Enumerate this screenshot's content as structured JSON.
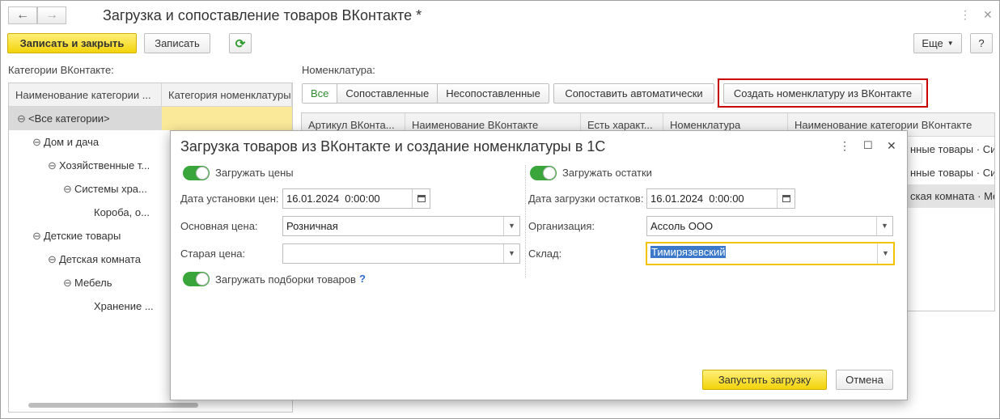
{
  "window": {
    "title": "Загрузка и сопоставление товаров ВКонтакте *"
  },
  "toolbar": {
    "save_close": "Записать и закрыть",
    "save": "Записать",
    "more": "Еще",
    "help": "?"
  },
  "left": {
    "label": "Категории ВКонтакте:",
    "columns": [
      "Наименование категории ...",
      "Категория номенклатуры"
    ],
    "rows": [
      {
        "text": "<Все категории>",
        "toggle": "⊖"
      },
      {
        "text": "Дом и дача",
        "toggle": "⊖"
      },
      {
        "text": "Хозяйственные т...",
        "toggle": "⊖"
      },
      {
        "text": "Системы хра...",
        "toggle": "⊖"
      },
      {
        "text": "Короба, о...",
        "toggle": ""
      },
      {
        "text": "Детские товары",
        "toggle": "⊖"
      },
      {
        "text": "Детская комната",
        "toggle": "⊖"
      },
      {
        "text": "Мебель",
        "toggle": "⊖"
      },
      {
        "text": "Хранение ...",
        "toggle": ""
      }
    ]
  },
  "right": {
    "label": "Номенклатура:",
    "filters": [
      "Все",
      "Сопоставленные",
      "Несопоставленные"
    ],
    "auto_match": "Сопоставить автоматически",
    "create_btn": "Создать номенклатуру из ВКонтакте",
    "columns": [
      "Артикул ВКонта...",
      "Наименование ВКонтакте",
      "Есть характ...",
      "Номенклатура",
      "Наименование категории ВКонтакте"
    ],
    "rows": [
      "нные товары · Си",
      "нные товары · Си",
      "ская комната · Мебе"
    ]
  },
  "dialog": {
    "title": "Загрузка товаров из ВКонтакте и создание номенклатуры в 1С",
    "load_prices": "Загружать цены",
    "price_date_label": "Дата установки цен:",
    "price_date": "16.01.2024  0:00:00",
    "base_price_label": "Основная цена:",
    "base_price": "Розничная",
    "old_price_label": "Старая цена:",
    "old_price": "",
    "load_collections": "Загружать подборки товаров",
    "help_q": "?",
    "load_stock": "Загружать остатки",
    "stock_date_label": "Дата загрузки остатков:",
    "stock_date": "16.01.2024  0:00:00",
    "org_label": "Организация:",
    "org": "Ассоль ООО",
    "warehouse_label": "Склад:",
    "warehouse": "Тимирязевский",
    "start": "Запустить загрузку",
    "cancel": "Отмена"
  }
}
